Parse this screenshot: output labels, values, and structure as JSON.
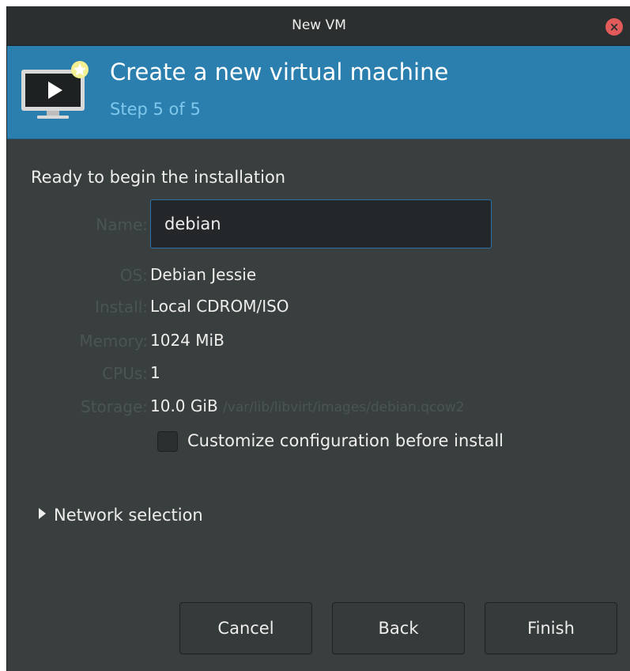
{
  "window": {
    "title": "New VM"
  },
  "banner": {
    "title": "Create a new virtual machine",
    "step": "Step 5 of 5"
  },
  "summary": {
    "heading": "Ready to begin the installation",
    "name_label": "Name:",
    "name_value": "debian",
    "os_label": "OS:",
    "os_value": "Debian Jessie",
    "install_label": "Install:",
    "install_value": "Local CDROM/ISO",
    "memory_label": "Memory:",
    "memory_value": "1024 MiB",
    "cpus_label": "CPUs:",
    "cpus_value": "1",
    "storage_label": "Storage:",
    "storage_value": "10.0 GiB",
    "storage_path": "/var/lib/libvirt/images/debian.qcow2"
  },
  "customize": {
    "label": "Customize configuration before install",
    "checked": false
  },
  "network": {
    "label": "Network selection"
  },
  "buttons": {
    "cancel": "Cancel",
    "back": "Back",
    "finish": "Finish"
  },
  "colors": {
    "accent": "#2a7fae",
    "step_text": "#7fc7ec",
    "window_bg": "#393f3f",
    "close": "#e25a5a"
  }
}
